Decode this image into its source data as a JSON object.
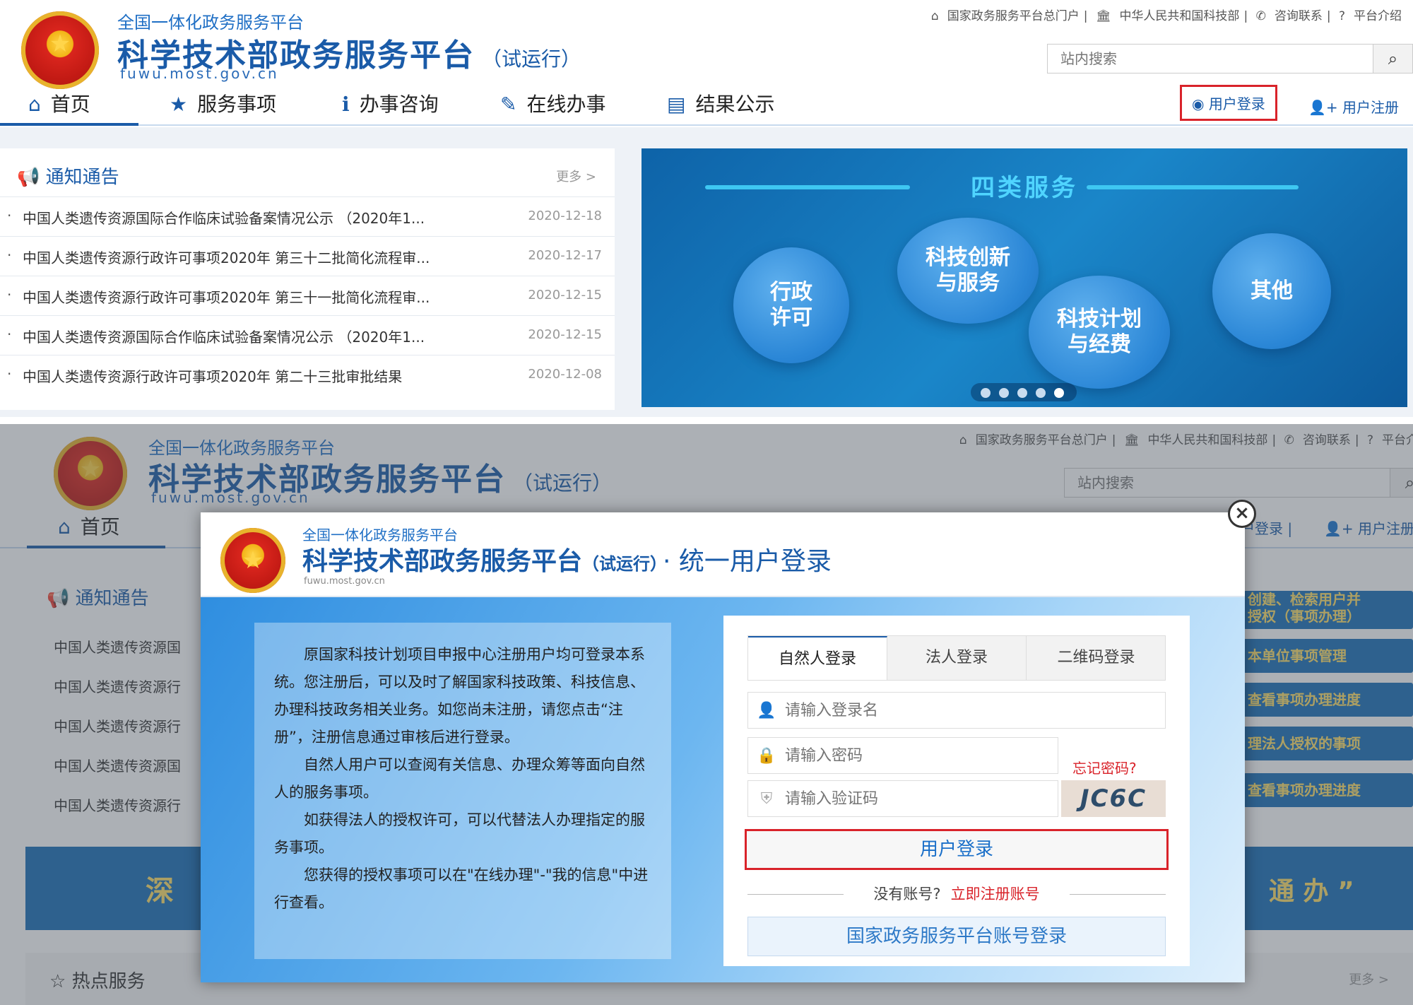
{
  "site": {
    "platform_line": "全国一体化政务服务平台",
    "title": "科学技术部政务服务平台",
    "trial": "（试运行）",
    "url": "fuwu.most.gov.cn"
  },
  "top_links": [
    "国家政务服务平台总门户",
    "中华人民共和国科技部",
    "咨询联系",
    "平台介绍"
  ],
  "top_links_cut": [
    "国家政务服务平台总门户",
    "中华人民共和国科技部",
    "咨询联系",
    "平台介绍"
  ],
  "search": {
    "placeholder": "站内搜索"
  },
  "nav": [
    "首页",
    "服务事项",
    "办事咨询",
    "在线办事",
    "结果公示"
  ],
  "user_login": "用户登录",
  "user_register": "用户注册",
  "user_login_cut": "户登录",
  "user_register_cut": "用户注册",
  "notice": {
    "title": "通知通告",
    "more": "更多 >",
    "items": [
      {
        "text": "中国人类遗传资源国际合作临床试验备案情况公示 （2020年1...",
        "date": "2020-12-18"
      },
      {
        "text": "中国人类遗传资源行政许可事项2020年 第三十二批简化流程审...",
        "date": "2020-12-17"
      },
      {
        "text": "中国人类遗传资源行政许可事项2020年 第三十一批简化流程审...",
        "date": "2020-12-15"
      },
      {
        "text": "中国人类遗传资源国际合作临床试验备案情况公示 （2020年1...",
        "date": "2020-12-15"
      },
      {
        "text": "中国人类遗传资源行政许可事项2020年 第二十三批审批结果",
        "date": "2020-12-08"
      }
    ],
    "items_cut": [
      "中国人类遗传资源国",
      "中国人类遗传资源行",
      "中国人类遗传资源行",
      "中国人类遗传资源国",
      "中国人类遗传资源行"
    ]
  },
  "banner": {
    "title": "四类服务",
    "bubbles": [
      "行政\n许可",
      "科技创新\n与服务",
      "科技计划\n与经费",
      "其他"
    ]
  },
  "bottom_bg": {
    "deep": "深",
    "tongban": "通 办 ”",
    "hot": "热点服务",
    "more": "更多 >",
    "side": [
      "创建、检索用户并\n授权（事项办理）",
      "本单位事项管理",
      "查看事项办理进度",
      "理法人授权的事项",
      "查看事项办理进度"
    ]
  },
  "modal": {
    "platform_line": "全国一体化政务服务平台",
    "title": "科学技术部政务服务平台",
    "trial": "（试运行）",
    "suffix": "· 统一用户登录",
    "url": "fuwu.most.gov.cn",
    "info": [
      "原国家科技计划项目申报中心注册用户均可登录本系统。您注册后，可以及时了解国家科技政策、科技信息、办理科技政务相关业务。如您尚未注册，请您点击“注册”，注册信息通过审核后进行登录。",
      "自然人用户可以查阅有关信息、办理众筹等面向自然人的服务事项。",
      "如获得法人的授权许可，可以代替法人办理指定的服务事项。",
      "您获得的授权事项可以在\"在线办理\"-\"我的信息\"中进行查看。"
    ],
    "tabs": [
      "自然人登录",
      "法人登录",
      "二维码登录"
    ],
    "username_placeholder": "请输入登录名",
    "password_placeholder": "请输入密码",
    "forgot": "忘记密码?",
    "captcha_placeholder": "请输入验证码",
    "captcha_text": "JC6C",
    "submit": "用户登录",
    "no_account": "没有账号?",
    "register_now": "立即注册账号",
    "gov_login": "国家政务服务平台账号登录"
  },
  "icons": {
    "home": "home-icon",
    "star": "star-icon",
    "info": "info-icon",
    "pencil": "pencil-icon",
    "list": "list-icon",
    "user": "user-circle-icon",
    "user_plus": "user-plus-icon",
    "megaphone": "megaphone-icon",
    "search": "search-icon",
    "close": "close-icon",
    "lock": "lock-icon",
    "shield": "shield-icon"
  },
  "colors": {
    "brand_blue": "#1a5ba8",
    "highlight_red": "#d9232a"
  }
}
